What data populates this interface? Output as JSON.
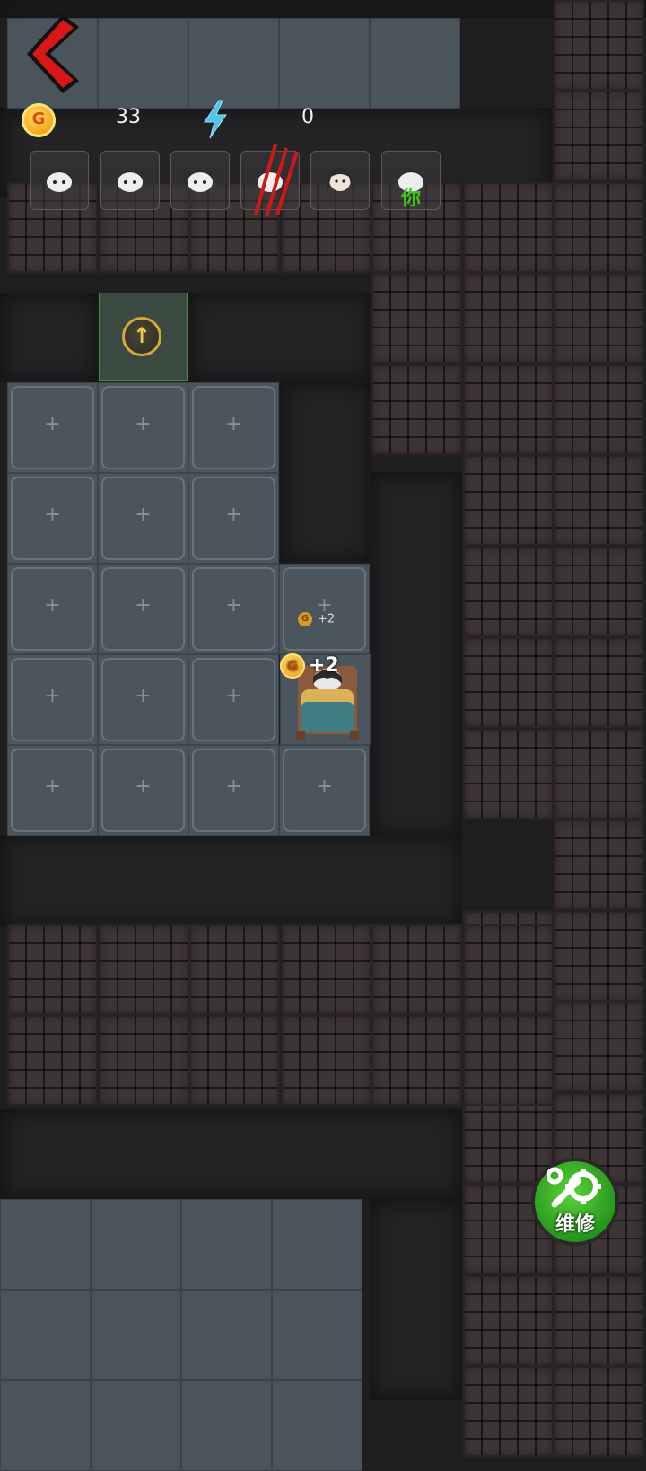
{
  "hud": {
    "coins": "33",
    "energy": "0",
    "coin_symbol": "G"
  },
  "players": [
    {
      "id": "ghost-1"
    },
    {
      "id": "ghost-2"
    },
    {
      "id": "ghost-3"
    },
    {
      "id": "ghost-attacked"
    },
    {
      "id": "girl"
    },
    {
      "id": "you",
      "label": "你"
    }
  ],
  "room": {
    "income_small": "+2",
    "income_big": "+2"
  },
  "actions": {
    "repair_label": "维修"
  },
  "colors": {
    "back_arrow": "#d81818",
    "coin": "#f0a81a",
    "energy": "#4fc3e8",
    "repair_button": "#2fae22",
    "you_label": "#3ec61c",
    "upgrade_ring": "#d4a83a"
  },
  "icons": [
    "back-arrow-icon",
    "coin-icon",
    "lightning-icon",
    "upgrade-arrow-icon",
    "wrench-gear-icon"
  ]
}
